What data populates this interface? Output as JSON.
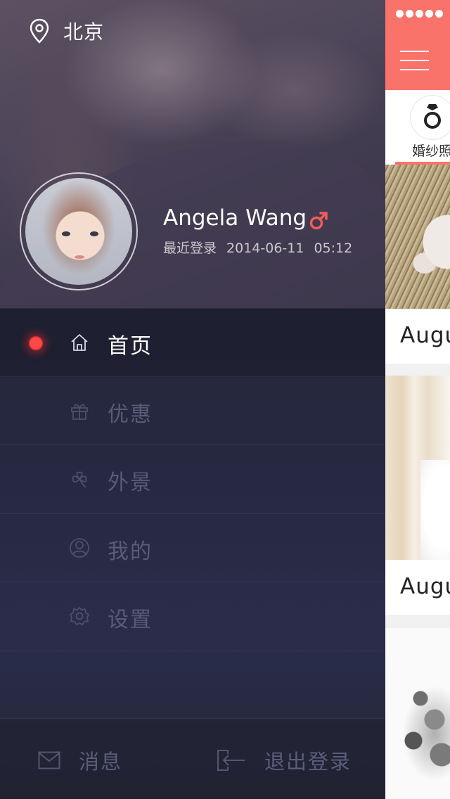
{
  "drawer": {
    "location": "北京",
    "user": {
      "name": "Angela Wang",
      "gender_icon": "male-symbol-icon",
      "last_login_label": "最近登录",
      "last_login_date": "2014-06-11",
      "last_login_time": "05:12"
    },
    "menu": [
      {
        "label": "首页",
        "icon": "home-icon",
        "active": true
      },
      {
        "label": "优惠",
        "icon": "gift-icon",
        "active": false
      },
      {
        "label": "外景",
        "icon": "clover-icon",
        "active": false
      },
      {
        "label": "我的",
        "icon": "user-icon",
        "active": false
      },
      {
        "label": "设置",
        "icon": "gear-icon",
        "active": false
      }
    ],
    "bottom": {
      "messages_label": "消息",
      "logout_label": "退出登录"
    }
  },
  "main": {
    "category_label": "婚纱照",
    "category_icon": "ring-icon",
    "cards": [
      {
        "title": "Augu"
      },
      {
        "title": "Augu"
      }
    ]
  },
  "colors": {
    "accent": "#f9736b",
    "active_dot": "#ea2c30",
    "menu_inactive": "#5a5b78"
  }
}
